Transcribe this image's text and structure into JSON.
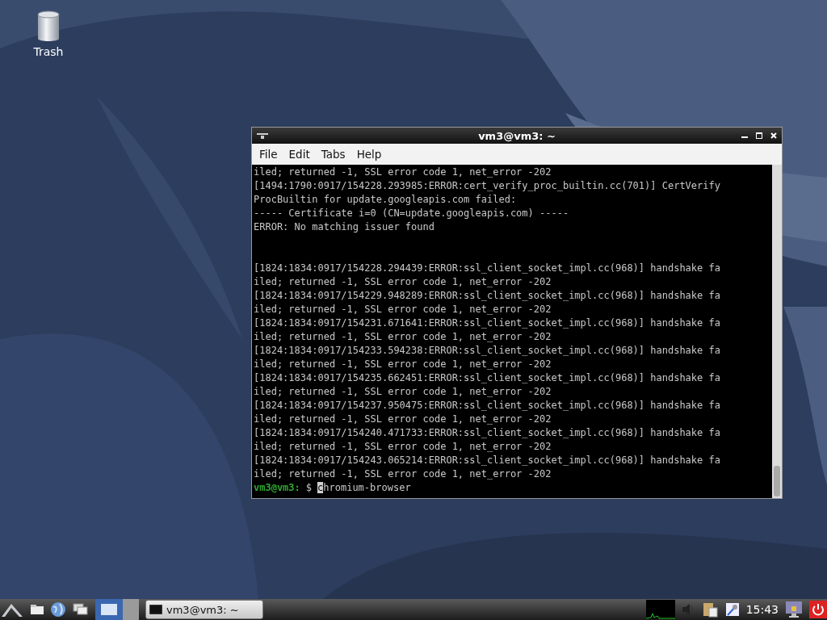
{
  "desktop_icons": [
    {
      "label": "Trash"
    }
  ],
  "window": {
    "title": "vm3@vm3: ~",
    "menu": [
      "File",
      "Edit",
      "Tabs",
      "Help"
    ],
    "blocks": [
      {
        "lines": [
          "iled; returned -1, SSL error code 1, net_error -202",
          "[1494:1790:0917/154228.293985:ERROR:cert_verify_proc_builtin.cc(701)] CertVerify",
          "ProcBuiltin for update.googleapis.com failed:",
          "----- Certificate i=0 (CN=update.googleapis.com) -----",
          "ERROR: No matching issuer found"
        ]
      },
      {
        "lines": [
          "[1824:1834:0917/154228.294439:ERROR:ssl_client_socket_impl.cc(968)] handshake fa",
          "iled; returned -1, SSL error code 1, net_error -202",
          "[1824:1834:0917/154229.948289:ERROR:ssl_client_socket_impl.cc(968)] handshake fa",
          "iled; returned -1, SSL error code 1, net_error -202",
          "[1824:1834:0917/154231.671641:ERROR:ssl_client_socket_impl.cc(968)] handshake fa",
          "iled; returned -1, SSL error code 1, net_error -202",
          "[1824:1834:0917/154233.594238:ERROR:ssl_client_socket_impl.cc(968)] handshake fa",
          "iled; returned -1, SSL error code 1, net_error -202",
          "[1824:1834:0917/154235.662451:ERROR:ssl_client_socket_impl.cc(968)] handshake fa",
          "iled; returned -1, SSL error code 1, net_error -202",
          "[1824:1834:0917/154237.950475:ERROR:ssl_client_socket_impl.cc(968)] handshake fa",
          "iled; returned -1, SSL error code 1, net_error -202",
          "[1824:1834:0917/154240.471733:ERROR:ssl_client_socket_impl.cc(968)] handshake fa",
          "iled; returned -1, SSL error code 1, net_error -202",
          "[1824:1834:0917/154243.065214:ERROR:ssl_client_socket_impl.cc(968)] handshake fa",
          "iled; returned -1, SSL error code 1, net_error -202"
        ]
      }
    ],
    "prompt": {
      "user": "vm3@vm3:",
      "symbol": "$",
      "command": "chromium-browser"
    }
  },
  "taskbar": {
    "tasks": [
      {
        "label": "vm3@vm3: ~",
        "selected": false
      }
    ],
    "clock": "15:43"
  }
}
